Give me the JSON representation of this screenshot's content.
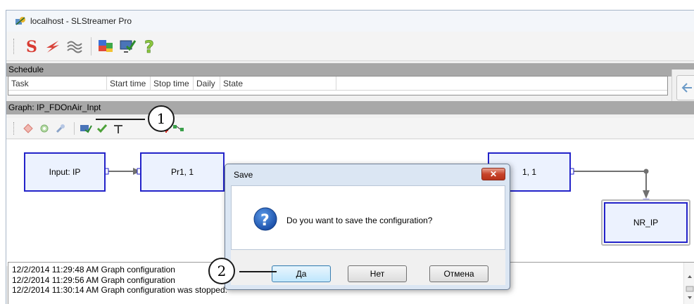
{
  "window": {
    "title": "localhost - SLStreamer Pro"
  },
  "toolbar": {
    "buttons": [
      {
        "icon": "s-letter-icon"
      },
      {
        "icon": "lightning-icon"
      },
      {
        "icon": "wave-icon"
      },
      {
        "icon": "flags-icon"
      },
      {
        "icon": "monitor-check-icon"
      },
      {
        "icon": "help-icon"
      }
    ]
  },
  "schedule": {
    "header": "Schedule",
    "columns": [
      "Task",
      "Start time",
      "Stop time",
      "Daily",
      "State"
    ]
  },
  "graph": {
    "header": "Graph: IP_FDOnAir_Inpt",
    "nodes": {
      "input": "Input: IP",
      "pr1": "Pr1, 1",
      "n11": "1, 1",
      "nrip": "NR_IP"
    }
  },
  "log": {
    "lines": [
      "12/2/2014 11:29:48 AM Graph configuration",
      "12/2/2014 11:29:56 AM Graph configuration",
      "12/2/2014 11:30:14 AM Graph configuration was stopped."
    ]
  },
  "dialog": {
    "title": "Save",
    "close_label": "✕",
    "message": "Do you want to save the configuration?",
    "yes_label": "Да",
    "no_label": "Нет",
    "cancel_label": "Отмена"
  },
  "callouts": {
    "one": "1",
    "two": "2"
  },
  "colors": {
    "node_border": "#2323c9",
    "node_fill": "#ecf2fe",
    "header_gray": "#a8a8a8"
  }
}
